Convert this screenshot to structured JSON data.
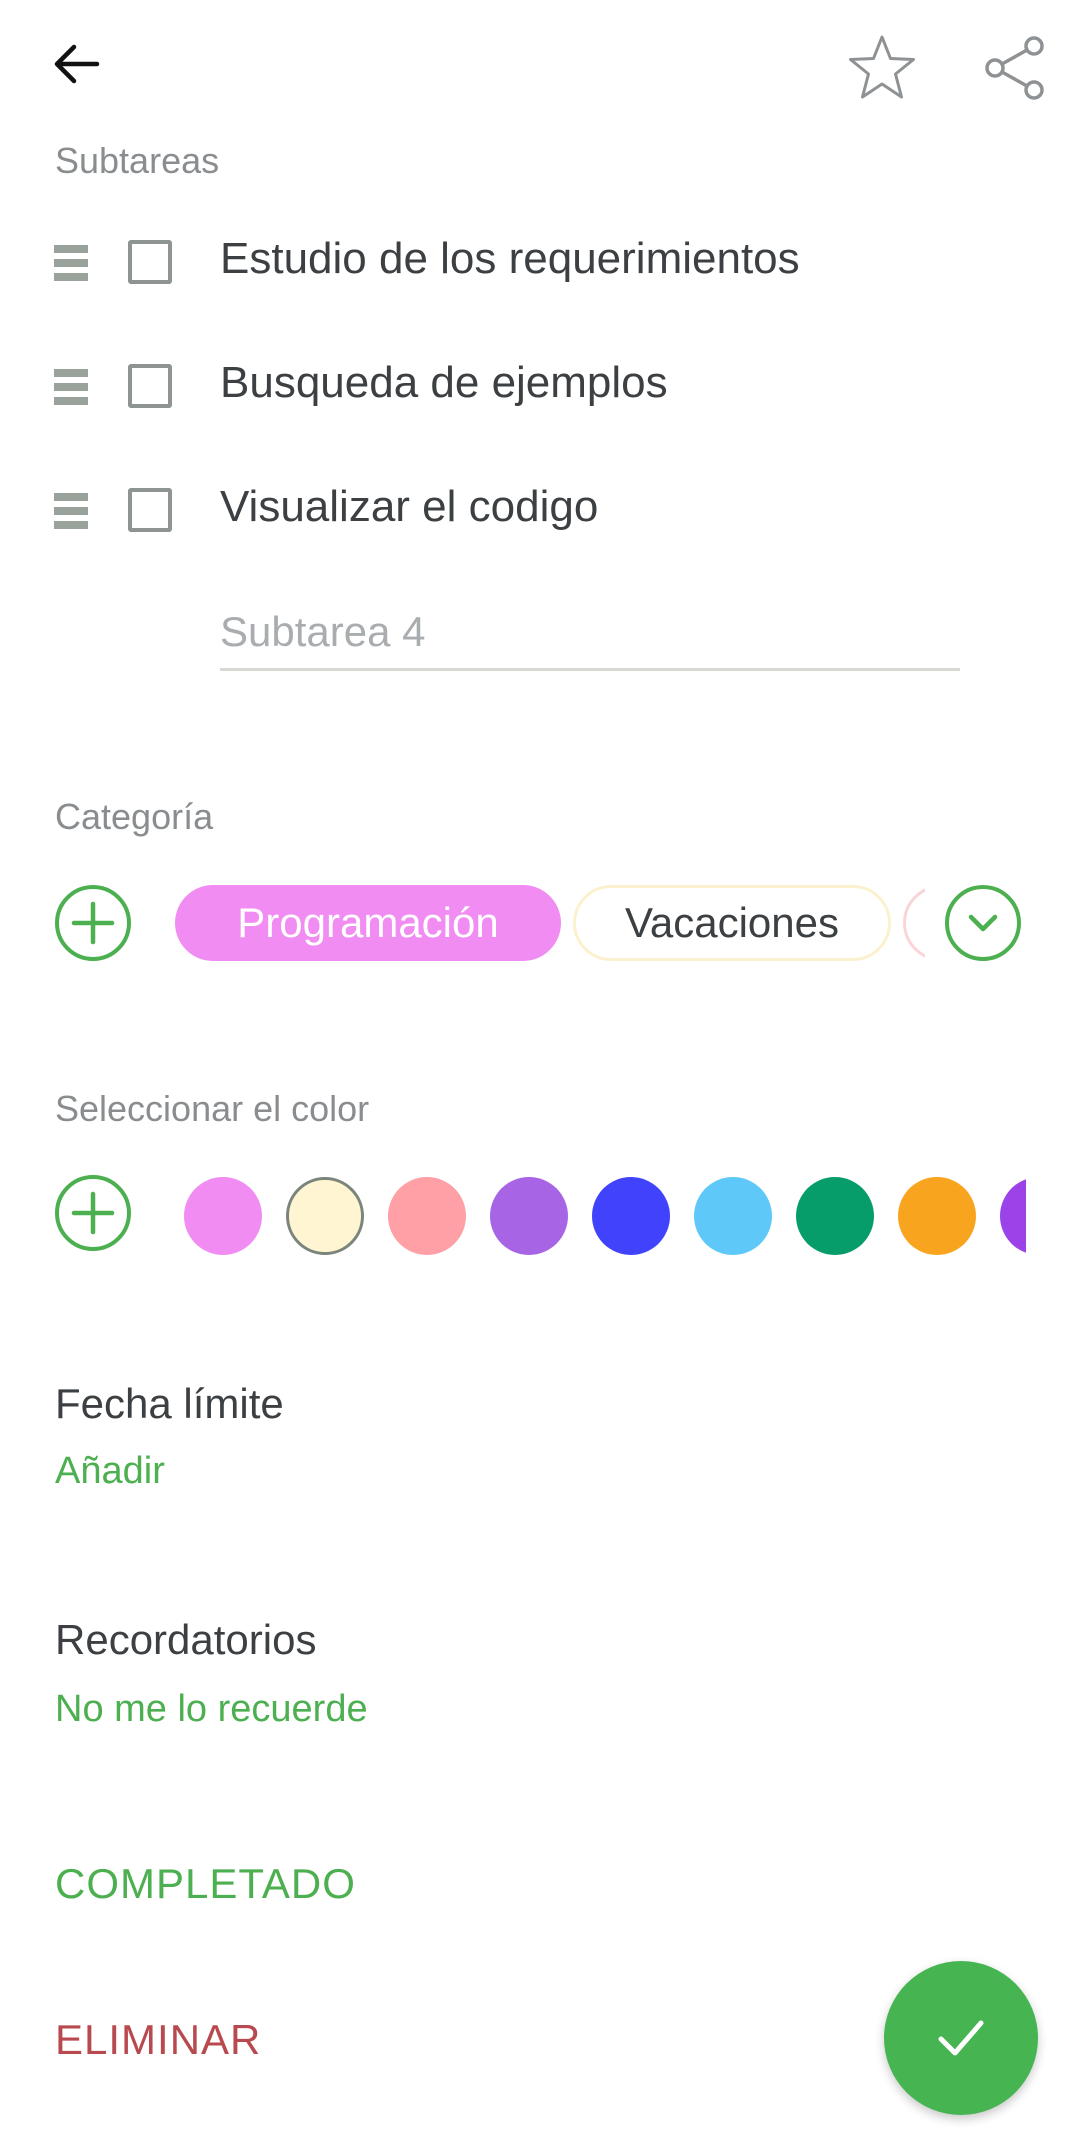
{
  "subtasks": {
    "label": "Subtareas",
    "items": [
      {
        "text": "Estudio de los requerimientos",
        "checked": false
      },
      {
        "text": "Busqueda de ejemplos",
        "checked": false
      },
      {
        "text": "Visualizar el codigo",
        "checked": false
      }
    ],
    "new_placeholder": "Subtarea 4"
  },
  "category": {
    "label": "Categoría",
    "chips": [
      {
        "label": "Programación",
        "color": "#f08cf2",
        "selected": true
      },
      {
        "label": "Vacaciones",
        "color": "#fbf1cf",
        "selected": false
      },
      {
        "label": "",
        "color": "#fad5d8",
        "selected": false
      }
    ]
  },
  "color": {
    "label": "Seleccionar el color",
    "swatches": [
      "#f08cf2",
      "#fff5d2",
      "#ff9fa6",
      "#a765e5",
      "#4043fb",
      "#5ec8f8",
      "#079d6b",
      "#f9a41e",
      "#9b42e9"
    ],
    "selected_index": 1
  },
  "deadline": {
    "title": "Fecha límite",
    "action": "Añadir"
  },
  "reminders": {
    "title": "Recordatorios",
    "value": "No me lo recuerde"
  },
  "actions": {
    "complete": "COMPLETADO",
    "delete": "ELIMINAR"
  },
  "theme": {
    "accent": "#4caf50",
    "danger": "#b84a4f",
    "fab": "#46b450"
  },
  "icons": {
    "back": "arrow-left-icon",
    "favorite": "star-icon",
    "share": "share-icon",
    "add": "plus-circle-icon",
    "expand": "chevron-down-icon",
    "drag": "drag-handle-icon",
    "confirm": "check-icon"
  }
}
